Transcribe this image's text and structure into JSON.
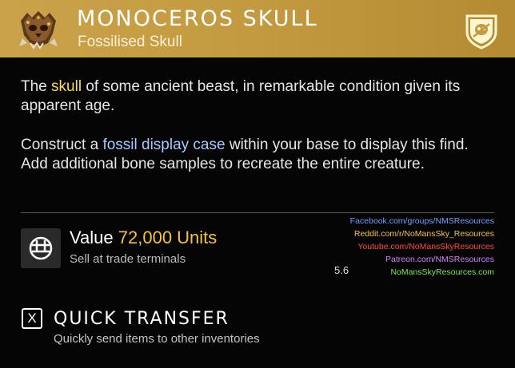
{
  "item": {
    "name": "MONOCEROS SKULL",
    "category": "Fossilised Skull",
    "icon": "skull-icon",
    "badge_icon": "shield-skull-icon"
  },
  "description": {
    "p1_pre": "The ",
    "p1_hl": "skull",
    "p1_post": " of some ancient beast, in remarkable condition given its apparent age.",
    "p2_pre": "Construct a ",
    "p2_hl": "fossil display case",
    "p2_post": " within your base to display this find. Add additional bone samples to recreate the entire creature."
  },
  "value": {
    "label": "Value",
    "amount": "72,000 Units",
    "subtext": "Sell at trade terminals",
    "icon": "units-icon"
  },
  "watermark": {
    "lines": [
      {
        "text": "Facebook.com/groups/NMSResources",
        "color": "#6fa0ff"
      },
      {
        "text": "Reddit.com/r/NoMansSky_Resources",
        "color": "#f5c33b"
      },
      {
        "text": "Youtube.com/NoMansSkyResources",
        "color": "#ff4a3a"
      },
      {
        "text": "Patreon.com/NMSResources",
        "color": "#d57cff"
      },
      {
        "text": "NoMansSkyResources.com",
        "color": "#7be35a"
      }
    ],
    "version": "5.6"
  },
  "quick_transfer": {
    "key": "X",
    "title": "QUICK TRANSFER",
    "subtitle": "Quickly send items to other inventories"
  },
  "colors": {
    "header_gold": "#c39a3f",
    "value_yellow": "#f5c33b",
    "highlight_yellow": "#f7dc5a",
    "highlight_blue": "#a8c8ff"
  }
}
